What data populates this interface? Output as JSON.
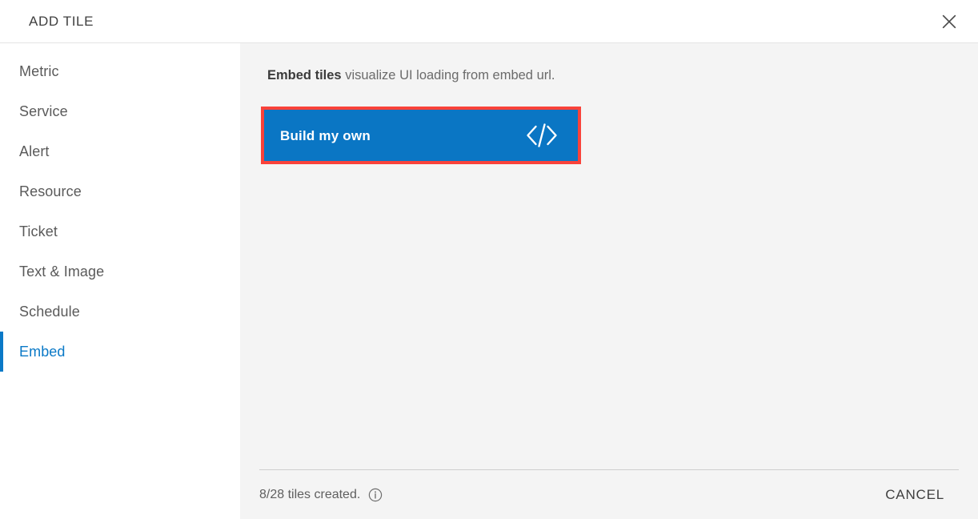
{
  "header": {
    "title": "ADD TILE",
    "close_icon": "close-icon"
  },
  "sidebar": {
    "items": [
      {
        "label": "Metric",
        "selected": false
      },
      {
        "label": "Service",
        "selected": false
      },
      {
        "label": "Alert",
        "selected": false
      },
      {
        "label": "Resource",
        "selected": false
      },
      {
        "label": "Ticket",
        "selected": false
      },
      {
        "label": "Text & Image",
        "selected": false
      },
      {
        "label": "Schedule",
        "selected": false
      },
      {
        "label": "Embed",
        "selected": true
      }
    ],
    "selected_label": "Embed"
  },
  "main": {
    "description_strong": "Embed tiles",
    "description_rest": " visualize UI loading from embed url.",
    "build_own": {
      "label": "Build my own",
      "icon": "code-icon",
      "highlighted": true
    }
  },
  "footer": {
    "tiles_created": "8/28 tiles created.",
    "info_icon": "info-icon",
    "cancel_label": "CANCEL"
  },
  "colors": {
    "accent_blue": "#0a79c7",
    "button_blue": "#0a76c4",
    "highlight_red": "#f9423a",
    "main_background": "#f4f4f4",
    "sidebar_background": "#ffffff"
  }
}
